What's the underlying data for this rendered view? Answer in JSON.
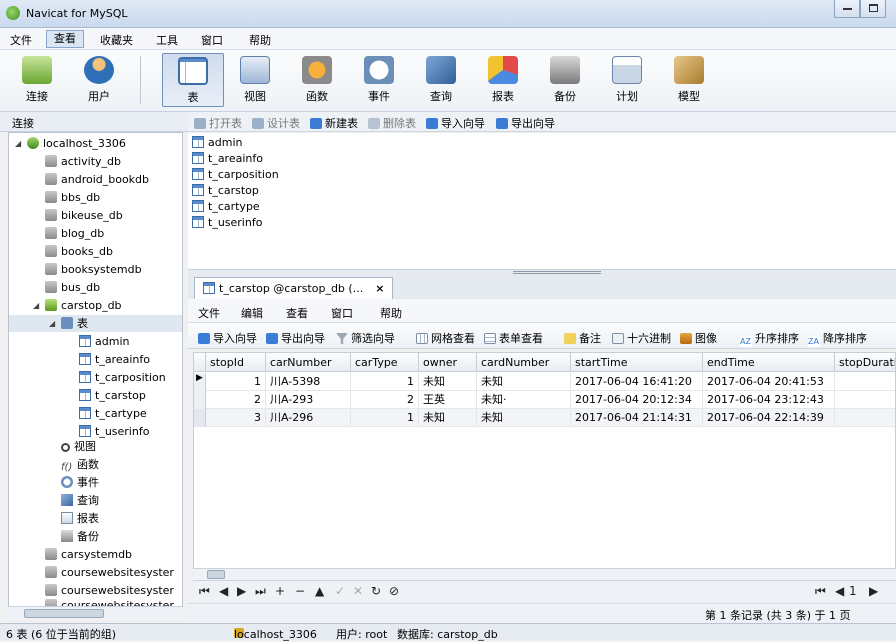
{
  "window": {
    "title": "Navicat for MySQL"
  },
  "menu": [
    "文件",
    "查看",
    "收藏夹",
    "工具",
    "窗口",
    "帮助"
  ],
  "toolbar": {
    "items": [
      "连接",
      "用户",
      "表",
      "视图",
      "函数",
      "事件",
      "查询",
      "报表",
      "备份",
      "计划",
      "模型"
    ],
    "selected": "表"
  },
  "connection_panel": {
    "header": "连接"
  },
  "tree": {
    "connection": "localhost_3306",
    "databases_before": [
      "activity_db",
      "android_bookdb",
      "bbs_db",
      "bikeuse_db",
      "blog_db",
      "books_db",
      "booksystemdb",
      "bus_db"
    ],
    "open_db": "carstop_db",
    "table_group": "表",
    "tables": [
      "admin",
      "t_areainfo",
      "t_carposition",
      "t_carstop",
      "t_cartype",
      "t_userinfo"
    ],
    "other_groups": [
      "视图",
      "函数",
      "事件",
      "查询",
      "报表",
      "备份"
    ],
    "databases_after": [
      "carsystemdb",
      "coursewebsitesyster",
      "coursewebsitesyster",
      "coursewebsitesyster"
    ]
  },
  "object_toolbar": [
    "打开表",
    "设计表",
    "新建表",
    "删除表",
    "导入向导",
    "导出向导"
  ],
  "object_list": [
    "admin",
    "t_areainfo",
    "t_carposition",
    "t_carstop",
    "t_cartype",
    "t_userinfo"
  ],
  "tab": {
    "label": "t_carstop @carstop_db (...",
    "close": "×"
  },
  "sub_menu": [
    "文件",
    "编辑",
    "查看",
    "窗口",
    "帮助"
  ],
  "sub_toolbar": [
    "导入向导",
    "导出向导",
    "筛选向导",
    "网格查看",
    "表单查看",
    "备注",
    "十六进制",
    "图像",
    "升序排序",
    "降序排序"
  ],
  "grid": {
    "columns": [
      "stopId",
      "carNumber",
      "carType",
      "owner",
      "cardNumber",
      "startTime",
      "endTime",
      "stopDuratio"
    ],
    "rows": [
      [
        "1",
        "川A-5398",
        "1",
        "未知",
        "未知",
        "2017-06-04 16:41:20",
        "2017-06-04 20:41:53",
        ""
      ],
      [
        "2",
        "川A-293",
        "2",
        "王英",
        "未知·",
        "2017-06-04 20:12:34",
        "2017-06-04 23:12:43",
        ""
      ],
      [
        "3",
        "川A-296",
        "1",
        "未知",
        "未知",
        "2017-06-04 21:14:31",
        "2017-06-04 22:14:39",
        ""
      ]
    ],
    "current_row_marker": "▶"
  },
  "nav_bar": {
    "buttons": [
      "⏮",
      "◀",
      "▶",
      "⏭",
      "+",
      "−",
      "▲",
      "✓",
      "✕",
      "↻",
      "⊘"
    ],
    "page": "1"
  },
  "record_info": "第 1 条记录 (共 3 条) 于 1 页",
  "status": {
    "left": "6 表 (6 位于当前的组)",
    "connection": "localhost_3306",
    "user": "用户: root",
    "database": "数据库: carstop_db"
  },
  "colors": {
    "accent": "#3b6ea8",
    "selection": "#dfe7f1"
  }
}
